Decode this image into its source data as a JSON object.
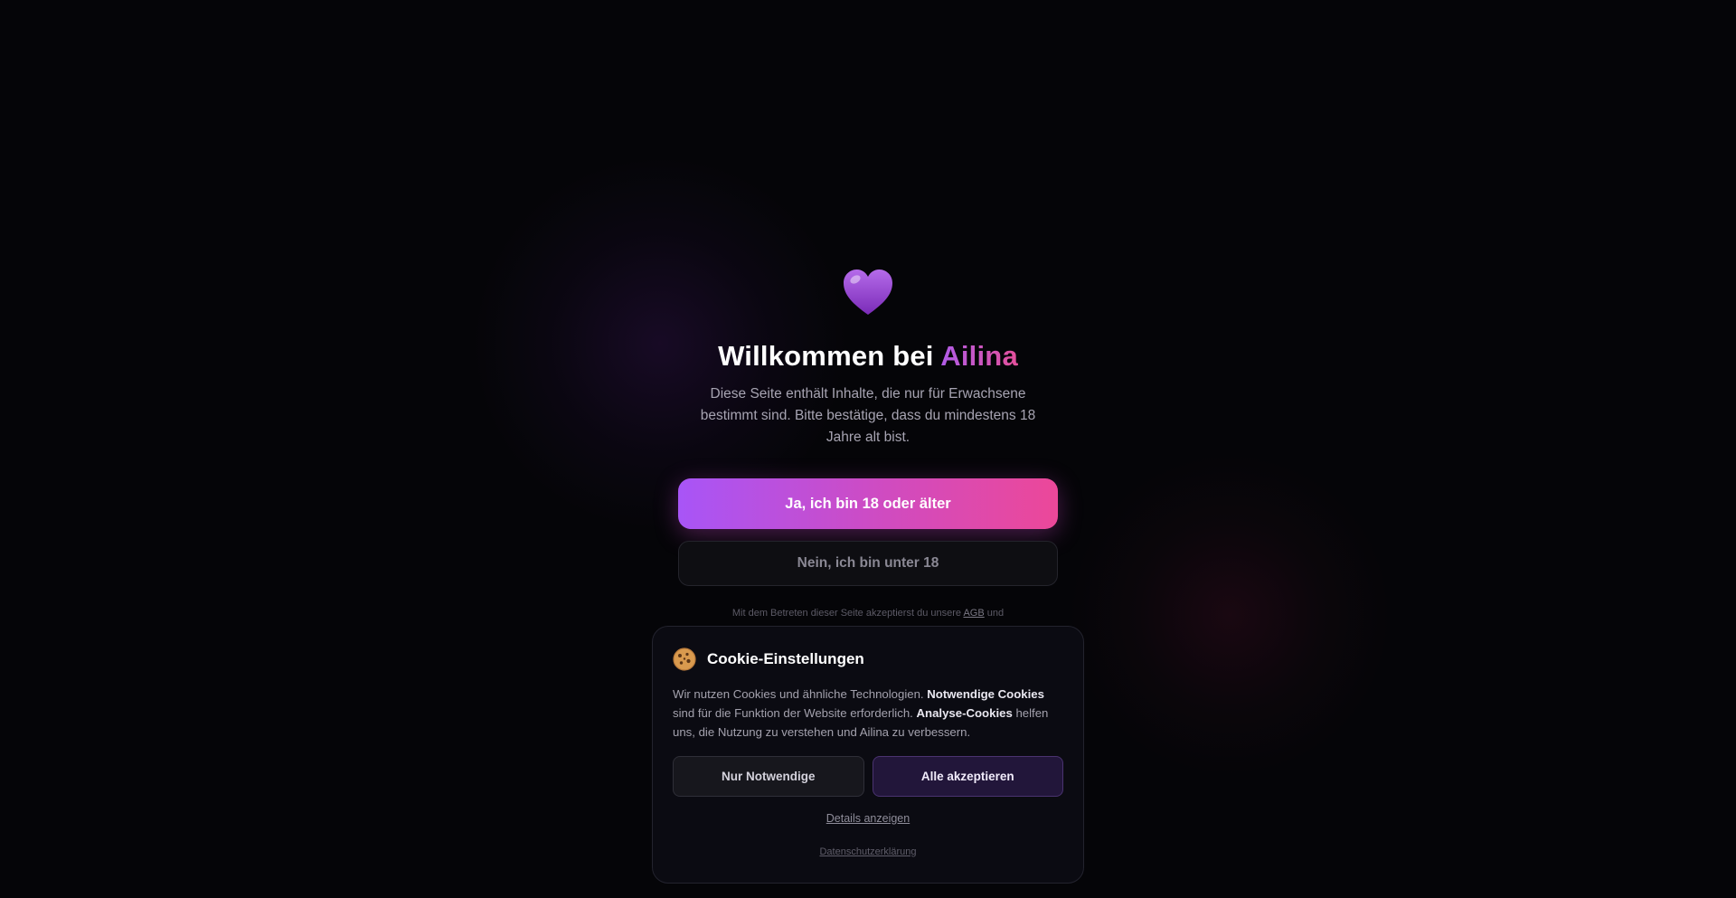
{
  "age_gate": {
    "heart_icon": "purple-heart-icon",
    "title_prefix": "Willkommen bei ",
    "title_brand": "Ailina",
    "description": "Diese Seite enthält Inhalte, die nur für Erwachsene bestimmt sind. Bitte bestätige, dass du mindestens 18 Jahre alt bist.",
    "confirm_label": "Ja, ich bin 18 oder älter",
    "deny_label": "Nein, ich bin unter 18",
    "legal_prefix": "Mit dem Betreten dieser Seite akzeptierst du unsere ",
    "legal_link": "AGB",
    "legal_suffix": " und"
  },
  "cookie_banner": {
    "icon": "cookie-icon",
    "title": "Cookie-Einstellungen",
    "text_1": "Wir nutzen Cookies und ähnliche Technologien. ",
    "text_bold_1": "Notwendige Cookies",
    "text_2": " sind für die Funktion der Website erforderlich. ",
    "text_bold_2": "Analyse-Cookies",
    "text_3": " helfen uns, die Nutzung zu verstehen und Ailina zu verbessern.",
    "necessary_label": "Nur Notwendige",
    "accept_label": "Alle akzeptieren",
    "details_label": "Details anzeigen",
    "privacy_label": "Datenschutzerklärung"
  },
  "colors": {
    "background": "#050508",
    "accent_purple": "#a855f7",
    "accent_pink": "#ec4899"
  }
}
